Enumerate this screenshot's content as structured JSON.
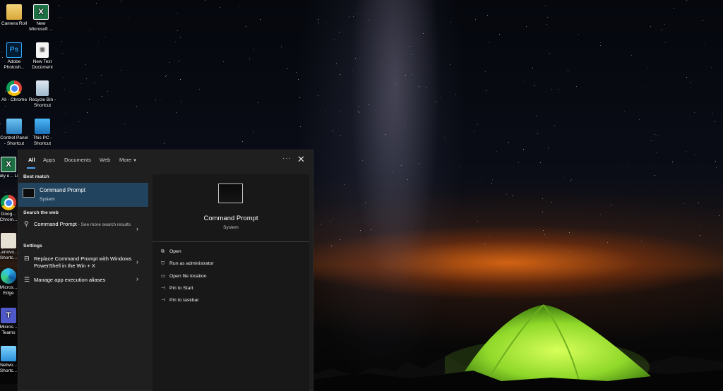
{
  "desktop_icons": [
    {
      "label": "Camera Roll",
      "icon": "folder-icon"
    },
    {
      "label": "New Microsoft ...",
      "icon": "excel-icon"
    },
    {
      "label": "Adobe Photosh...",
      "icon": "photoshop-icon",
      "glyph": "Ps"
    },
    {
      "label": "New Text Document",
      "icon": "text-document-icon"
    },
    {
      "label": "Ali - Chrome",
      "icon": "chrome-icon"
    },
    {
      "label": "Recycle Bin - Shortcut",
      "icon": "recycle-bin-icon"
    },
    {
      "label": "Control Panel - Shortcut",
      "icon": "control-panel-icon"
    },
    {
      "label": "This PC - Shortcut",
      "icon": "this-pc-icon"
    },
    {
      "label": "Daily e... List",
      "icon": "excel-icon"
    },
    {
      "label": "Goog... Chrom...",
      "icon": "chrome-icon"
    },
    {
      "label": "Lenovo... Shortc...",
      "icon": "lenovo-icon"
    },
    {
      "label": "Micros... Edge",
      "icon": "edge-icon"
    },
    {
      "label": "Micros... Teams",
      "icon": "teams-icon"
    },
    {
      "label": "Netwo... Shortc...",
      "icon": "network-icon"
    }
  ],
  "search": {
    "tabs": [
      "All",
      "Apps",
      "Documents",
      "Web",
      "More"
    ],
    "active_tab": "All",
    "best_match_heading": "Best match",
    "best_match": {
      "title": "Command Prompt",
      "subtitle": "System"
    },
    "search_web_heading": "Search the web",
    "web_result": {
      "query": "Command Prompt",
      "suffix": " - See more search results"
    },
    "settings_heading": "Settings",
    "settings_items": [
      "Replace Command Prompt with Windows PowerShell in the Win + X",
      "Manage app execution aliases"
    ],
    "detail": {
      "title": "Command Prompt",
      "subtitle": "System",
      "actions": [
        "Open",
        "Run as administrator",
        "Open file location",
        "Pin to Start",
        "Pin to taskbar"
      ]
    }
  },
  "colors": {
    "panel_bg": "#1f1f1f",
    "selection": "#22435d",
    "accent": "#4ea1f3"
  }
}
